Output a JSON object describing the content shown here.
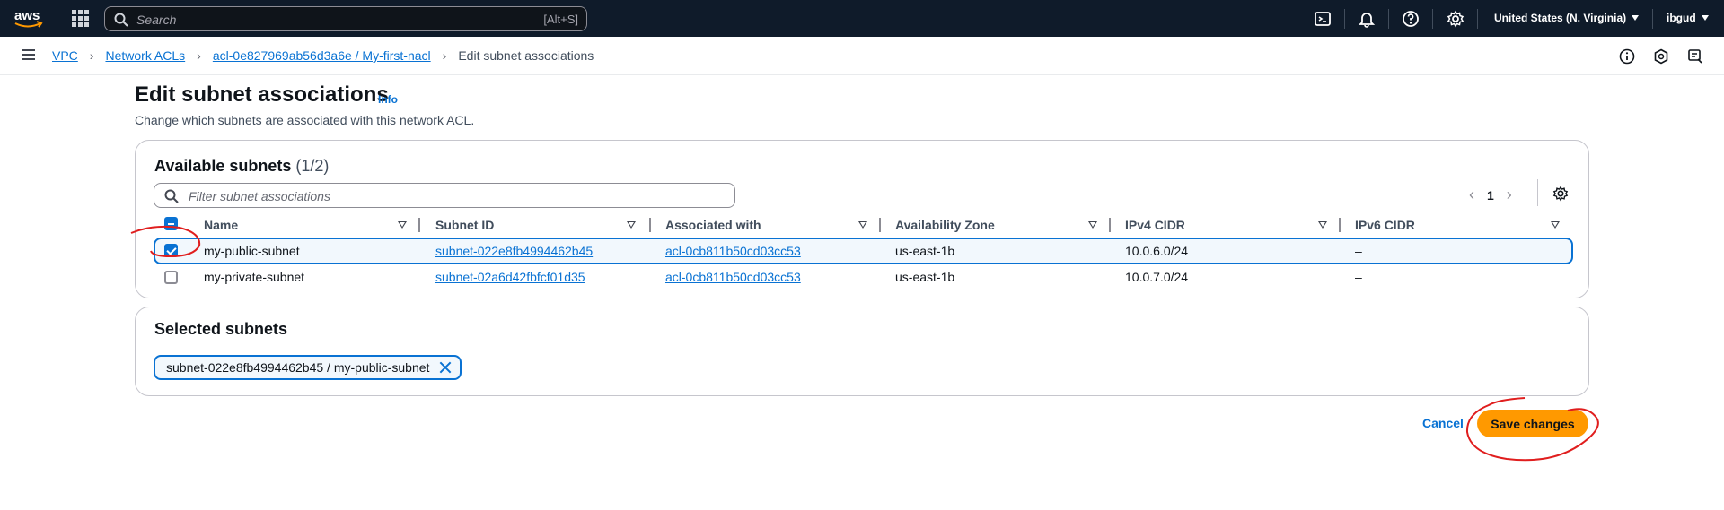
{
  "topnav": {
    "logo_text": "aws",
    "search_placeholder": "Search",
    "search_shortcut": "[Alt+S]",
    "region": "United States (N. Virginia)",
    "user": "ibgud",
    "icons": [
      "cloudshell-icon",
      "bell-icon",
      "help-icon",
      "gear-icon"
    ]
  },
  "breadcrumb": {
    "items": [
      "VPC",
      "Network ACLs",
      "acl-0e827969ab56d3a6e / My-first-nacl"
    ],
    "current": "Edit subnet associations"
  },
  "header": {
    "title": "Edit subnet associations",
    "info": "Info",
    "description": "Change which subnets are associated with this network ACL."
  },
  "available": {
    "title": "Available subnets",
    "count": "(1/2)",
    "filter_placeholder": "Filter subnet associations",
    "page": "1",
    "columns": [
      "Name",
      "Subnet ID",
      "Associated with",
      "Availability Zone",
      "IPv4 CIDR",
      "IPv6 CIDR"
    ],
    "rows": [
      {
        "selected": true,
        "name": "my-public-subnet",
        "subnet_id": "subnet-022e8fb4994462b45",
        "associated": "acl-0cb811b50cd03cc53",
        "az": "us-east-1b",
        "ipv4": "10.0.6.0/24",
        "ipv6": "–"
      },
      {
        "selected": false,
        "name": "my-private-subnet",
        "subnet_id": "subnet-02a6d42fbfcf01d35",
        "associated": "acl-0cb811b50cd03cc53",
        "az": "us-east-1b",
        "ipv4": "10.0.7.0/24",
        "ipv6": "–"
      }
    ]
  },
  "selected": {
    "title": "Selected subnets",
    "token": "subnet-022e8fb4994462b45 / my-public-subnet"
  },
  "actions": {
    "cancel": "Cancel",
    "save": "Save changes"
  },
  "colors": {
    "nav_bg": "#0f1b2a",
    "link": "#0972d3",
    "primary_button": "#ff9900",
    "annotation": "#e01e1e"
  }
}
